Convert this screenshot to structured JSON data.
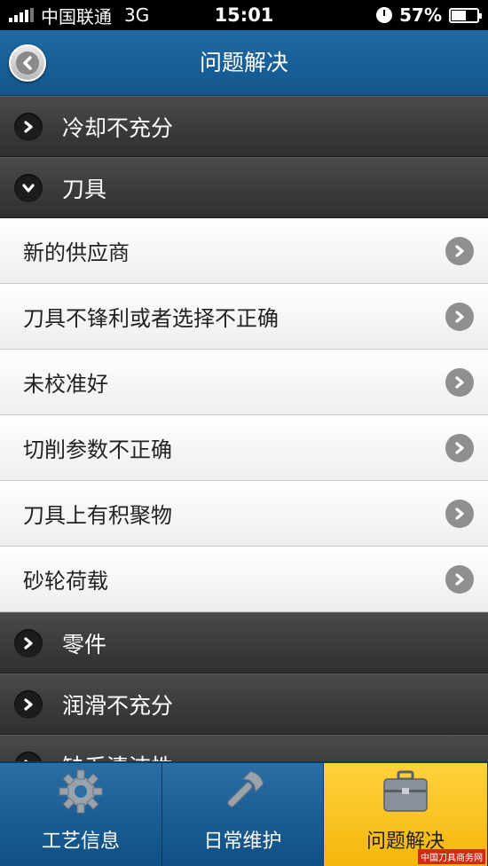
{
  "status_bar": {
    "carrier": "中国联通",
    "network": "3G",
    "time": "15:01",
    "battery": "57%",
    "battery_level": 0.57
  },
  "header": {
    "title": "问题解决"
  },
  "sections": [
    {
      "label": "冷却不充分",
      "expanded": false,
      "items": []
    },
    {
      "label": "刀具",
      "expanded": true,
      "items": [
        "新的供应商",
        "刀具不锋利或者选择不正确",
        "未校准好",
        "切削参数不正确",
        "刀具上有积聚物",
        "砂轮荷载"
      ]
    },
    {
      "label": "零件",
      "expanded": false,
      "items": []
    },
    {
      "label": "润滑不充分",
      "expanded": false,
      "items": []
    },
    {
      "label": "缺乏清洁性",
      "expanded": false,
      "items": []
    }
  ],
  "tabs": [
    {
      "label": "工艺信息",
      "icon": "gear-icon",
      "active": false
    },
    {
      "label": "日常维护",
      "icon": "wrench-icon",
      "active": false
    },
    {
      "label": "问题解决",
      "icon": "toolbox-icon",
      "active": true
    }
  ],
  "watermark": "中国刀具商务网",
  "colors": {
    "header": "#13568d",
    "active_tab": "#f4b60c",
    "section": "#3a3a3a"
  }
}
